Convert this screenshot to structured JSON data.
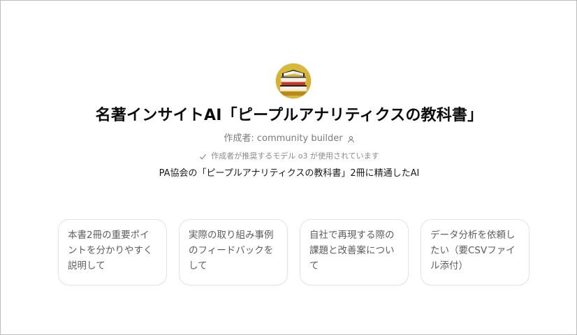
{
  "gpt": {
    "avatar_icon": "stacked-books-icon",
    "title": "名著インサイトAI「ピープルアナリティクスの教科書」",
    "author": "作成者: community builder",
    "author_icon": "person-icon",
    "model_note": "作成者が推奨するモデル o3 が使用されています",
    "model_icon": "check-icon",
    "description": "PA協会の「ピープルアナリティクスの教科書」2冊に精通したAI"
  },
  "conversation_starters": [
    {
      "text": "本書2冊の重要ポイントを分かりやすく説明して"
    },
    {
      "text": "実際の取り組み事例のフィードバックをして"
    },
    {
      "text": "自社で再現する際の課題と改善案について"
    },
    {
      "text": "データ分析を依頼したい（要CSVファイル添付）"
    }
  ],
  "colors": {
    "title": "#0d0d0d",
    "muted": "#7a7a7a",
    "card_border": "#e3e3e3",
    "card_text": "#5d5d5d"
  }
}
